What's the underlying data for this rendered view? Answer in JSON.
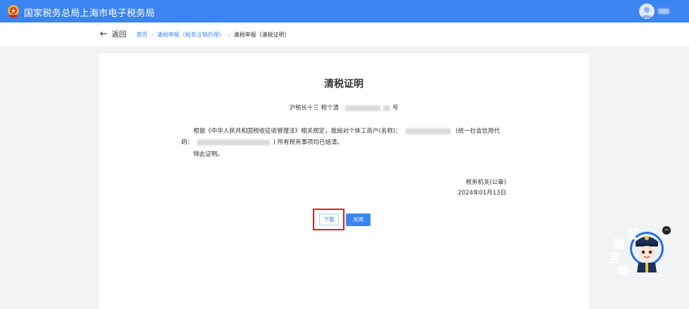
{
  "header": {
    "site_title": "国家税务总局上海市电子税务局",
    "user_name": "",
    "logo_icon": "tax-emblem-icon",
    "avatar_icon": "user-avatar-icon",
    "bg_color": "#3c84f0"
  },
  "nav": {
    "back_label": "返回",
    "breadcrumbs": [
      "首页",
      "清税申报（税务注销办理）",
      "清税申报（清税证明）"
    ]
  },
  "document": {
    "title": "清税证明",
    "number_prefix": "沪税长十三 税个清",
    "number_suffix": "号",
    "para1_a": "根据《中华人民共和国税收征收管理法》相关规定，我局对个体工商户(名称)：",
    "para1_b": "(统一社会信用代码：",
    "para1_c": ") 所有税务事项均已结清。",
    "para2": "特此证明。",
    "authority": "税务机关(公章)",
    "date": "2024年01月13日"
  },
  "actions": {
    "download_label": "下载",
    "close_label": "关闭",
    "highlight_color": "#e02020"
  },
  "assistant": {
    "chars": [
      "征",
      "纳",
      "互",
      "动"
    ],
    "close_symbol": "−"
  }
}
